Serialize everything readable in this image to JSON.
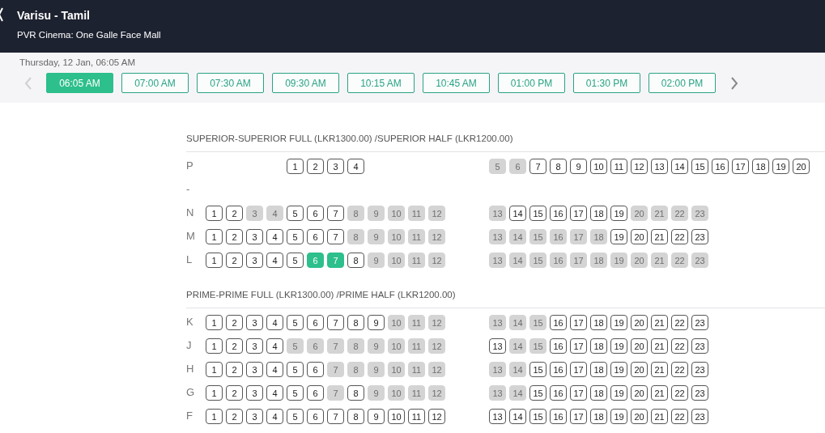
{
  "header": {
    "title": "Varisu - Tamil",
    "subtitle": "PVR Cinema: One Galle Face Mall"
  },
  "date": "Thursday, 12 Jan, 06:05 AM",
  "showtimes": [
    {
      "label": "06:05 AM",
      "selected": true
    },
    {
      "label": "07:00 AM",
      "selected": false
    },
    {
      "label": "07:30 AM",
      "selected": false
    },
    {
      "label": "09:30 AM",
      "selected": false
    },
    {
      "label": "10:15 AM",
      "selected": false
    },
    {
      "label": "10:45 AM",
      "selected": false
    },
    {
      "label": "01:00 PM",
      "selected": false
    },
    {
      "label": "01:30 PM",
      "selected": false
    },
    {
      "label": "02:00 PM",
      "selected": false
    }
  ],
  "sections": [
    {
      "title": "SUPERIOR-SUPERIOR FULL (LKR1300.00) /SUPERIOR HALF (LKR1200.00)",
      "rows": [
        {
          "label": "P",
          "blocks": [
            [
              {
                "number": "1",
                "sold": false,
                "selected": false
              },
              {
                "number": "2",
                "sold": false,
                "selected": false
              },
              {
                "number": "3",
                "sold": false,
                "selected": false
              },
              {
                "number": "4",
                "sold": false,
                "selected": false
              }
            ],
            [
              {
                "number": "5",
                "sold": true,
                "selected": false
              },
              {
                "number": "6",
                "sold": true,
                "selected": false
              },
              {
                "number": "7",
                "sold": false,
                "selected": false
              },
              {
                "number": "8",
                "sold": false,
                "selected": false
              },
              {
                "number": "9",
                "sold": false,
                "selected": false
              },
              {
                "number": "10",
                "sold": false,
                "selected": false
              },
              {
                "number": "11",
                "sold": false,
                "selected": false
              },
              {
                "number": "12",
                "sold": false,
                "selected": false
              },
              {
                "number": "13",
                "sold": false,
                "selected": false
              },
              {
                "number": "14",
                "sold": false,
                "selected": false
              },
              {
                "number": "15",
                "sold": false,
                "selected": false
              },
              {
                "number": "16",
                "sold": false,
                "selected": false
              },
              {
                "number": "17",
                "sold": false,
                "selected": false
              },
              {
                "number": "18",
                "sold": false,
                "selected": false
              },
              {
                "number": "19",
                "sold": false,
                "selected": false
              },
              {
                "number": "20",
                "sold": false,
                "selected": false
              }
            ]
          ]
        },
        {
          "label": "-",
          "blocks": []
        },
        {
          "label": "N",
          "blocks": [
            [
              {
                "number": "1",
                "sold": false,
                "selected": false
              },
              {
                "number": "2",
                "sold": false,
                "selected": false
              },
              {
                "number": "3",
                "sold": true,
                "selected": false
              },
              {
                "number": "4",
                "sold": true,
                "selected": false
              },
              {
                "number": "5",
                "sold": false,
                "selected": false
              },
              {
                "number": "6",
                "sold": false,
                "selected": false
              },
              {
                "number": "7",
                "sold": false,
                "selected": false
              },
              {
                "number": "8",
                "sold": true,
                "selected": false
              },
              {
                "number": "9",
                "sold": true,
                "selected": false
              },
              {
                "number": "10",
                "sold": true,
                "selected": false
              },
              {
                "number": "11",
                "sold": true,
                "selected": false
              },
              {
                "number": "12",
                "sold": true,
                "selected": false
              }
            ],
            [
              {
                "number": "13",
                "sold": true,
                "selected": false
              },
              {
                "number": "14",
                "sold": false,
                "selected": false
              },
              {
                "number": "15",
                "sold": false,
                "selected": false
              },
              {
                "number": "16",
                "sold": false,
                "selected": false
              },
              {
                "number": "17",
                "sold": false,
                "selected": false
              },
              {
                "number": "18",
                "sold": false,
                "selected": false
              },
              {
                "number": "19",
                "sold": false,
                "selected": false
              },
              {
                "number": "20",
                "sold": true,
                "selected": false
              },
              {
                "number": "21",
                "sold": true,
                "selected": false
              },
              {
                "number": "22",
                "sold": true,
                "selected": false
              },
              {
                "number": "23",
                "sold": true,
                "selected": false
              }
            ]
          ]
        },
        {
          "label": "M",
          "blocks": [
            [
              {
                "number": "1",
                "sold": false,
                "selected": false
              },
              {
                "number": "2",
                "sold": false,
                "selected": false
              },
              {
                "number": "3",
                "sold": false,
                "selected": false
              },
              {
                "number": "4",
                "sold": false,
                "selected": false
              },
              {
                "number": "5",
                "sold": false,
                "selected": false
              },
              {
                "number": "6",
                "sold": false,
                "selected": false
              },
              {
                "number": "7",
                "sold": false,
                "selected": false
              },
              {
                "number": "8",
                "sold": true,
                "selected": false
              },
              {
                "number": "9",
                "sold": true,
                "selected": false
              },
              {
                "number": "10",
                "sold": true,
                "selected": false
              },
              {
                "number": "11",
                "sold": true,
                "selected": false
              },
              {
                "number": "12",
                "sold": true,
                "selected": false
              }
            ],
            [
              {
                "number": "13",
                "sold": true,
                "selected": false
              },
              {
                "number": "14",
                "sold": true,
                "selected": false
              },
              {
                "number": "15",
                "sold": true,
                "selected": false
              },
              {
                "number": "16",
                "sold": true,
                "selected": false
              },
              {
                "number": "17",
                "sold": true,
                "selected": false
              },
              {
                "number": "18",
                "sold": true,
                "selected": false
              },
              {
                "number": "19",
                "sold": false,
                "selected": false
              },
              {
                "number": "20",
                "sold": false,
                "selected": false
              },
              {
                "number": "21",
                "sold": false,
                "selected": false
              },
              {
                "number": "22",
                "sold": false,
                "selected": false
              },
              {
                "number": "23",
                "sold": false,
                "selected": false
              }
            ]
          ]
        },
        {
          "label": "L",
          "blocks": [
            [
              {
                "number": "1",
                "sold": false,
                "selected": false
              },
              {
                "number": "2",
                "sold": false,
                "selected": false
              },
              {
                "number": "3",
                "sold": false,
                "selected": false
              },
              {
                "number": "4",
                "sold": false,
                "selected": false
              },
              {
                "number": "5",
                "sold": false,
                "selected": false
              },
              {
                "number": "6",
                "sold": false,
                "selected": true
              },
              {
                "number": "7",
                "sold": false,
                "selected": true
              },
              {
                "number": "8",
                "sold": false,
                "selected": false
              },
              {
                "number": "9",
                "sold": true,
                "selected": false
              },
              {
                "number": "10",
                "sold": true,
                "selected": false
              },
              {
                "number": "11",
                "sold": true,
                "selected": false
              },
              {
                "number": "12",
                "sold": true,
                "selected": false
              }
            ],
            [
              {
                "number": "13",
                "sold": true,
                "selected": false
              },
              {
                "number": "14",
                "sold": true,
                "selected": false
              },
              {
                "number": "15",
                "sold": true,
                "selected": false
              },
              {
                "number": "16",
                "sold": true,
                "selected": false
              },
              {
                "number": "17",
                "sold": true,
                "selected": false
              },
              {
                "number": "18",
                "sold": true,
                "selected": false
              },
              {
                "number": "19",
                "sold": true,
                "selected": false
              },
              {
                "number": "20",
                "sold": true,
                "selected": false
              },
              {
                "number": "21",
                "sold": true,
                "selected": false
              },
              {
                "number": "22",
                "sold": true,
                "selected": false
              },
              {
                "number": "23",
                "sold": true,
                "selected": false
              }
            ]
          ]
        }
      ]
    },
    {
      "title": "PRIME-PRIME FULL (LKR1300.00) /PRIME HALF (LKR1200.00)",
      "rows": [
        {
          "label": "K",
          "blocks": [
            [
              {
                "number": "1",
                "sold": false,
                "selected": false
              },
              {
                "number": "2",
                "sold": false,
                "selected": false
              },
              {
                "number": "3",
                "sold": false,
                "selected": false
              },
              {
                "number": "4",
                "sold": false,
                "selected": false
              },
              {
                "number": "5",
                "sold": false,
                "selected": false
              },
              {
                "number": "6",
                "sold": false,
                "selected": false
              },
              {
                "number": "7",
                "sold": false,
                "selected": false
              },
              {
                "number": "8",
                "sold": false,
                "selected": false
              },
              {
                "number": "9",
                "sold": false,
                "selected": false
              },
              {
                "number": "10",
                "sold": true,
                "selected": false
              },
              {
                "number": "11",
                "sold": true,
                "selected": false
              },
              {
                "number": "12",
                "sold": true,
                "selected": false
              }
            ],
            [
              {
                "number": "13",
                "sold": true,
                "selected": false
              },
              {
                "number": "14",
                "sold": true,
                "selected": false
              },
              {
                "number": "15",
                "sold": true,
                "selected": false
              },
              {
                "number": "16",
                "sold": false,
                "selected": false
              },
              {
                "number": "17",
                "sold": false,
                "selected": false
              },
              {
                "number": "18",
                "sold": false,
                "selected": false
              },
              {
                "number": "19",
                "sold": false,
                "selected": false
              },
              {
                "number": "20",
                "sold": false,
                "selected": false
              },
              {
                "number": "21",
                "sold": false,
                "selected": false
              },
              {
                "number": "22",
                "sold": false,
                "selected": false
              },
              {
                "number": "23",
                "sold": false,
                "selected": false
              }
            ]
          ]
        },
        {
          "label": "J",
          "blocks": [
            [
              {
                "number": "1",
                "sold": false,
                "selected": false
              },
              {
                "number": "2",
                "sold": false,
                "selected": false
              },
              {
                "number": "3",
                "sold": false,
                "selected": false
              },
              {
                "number": "4",
                "sold": false,
                "selected": false
              },
              {
                "number": "5",
                "sold": true,
                "selected": false
              },
              {
                "number": "6",
                "sold": true,
                "selected": false
              },
              {
                "number": "7",
                "sold": true,
                "selected": false
              },
              {
                "number": "8",
                "sold": true,
                "selected": false
              },
              {
                "number": "9",
                "sold": true,
                "selected": false
              },
              {
                "number": "10",
                "sold": true,
                "selected": false
              },
              {
                "number": "11",
                "sold": true,
                "selected": false
              },
              {
                "number": "12",
                "sold": true,
                "selected": false
              }
            ],
            [
              {
                "number": "13",
                "sold": false,
                "selected": false
              },
              {
                "number": "14",
                "sold": true,
                "selected": false
              },
              {
                "number": "15",
                "sold": true,
                "selected": false
              },
              {
                "number": "16",
                "sold": false,
                "selected": false
              },
              {
                "number": "17",
                "sold": false,
                "selected": false
              },
              {
                "number": "18",
                "sold": false,
                "selected": false
              },
              {
                "number": "19",
                "sold": false,
                "selected": false
              },
              {
                "number": "20",
                "sold": false,
                "selected": false
              },
              {
                "number": "21",
                "sold": false,
                "selected": false
              },
              {
                "number": "22",
                "sold": false,
                "selected": false
              },
              {
                "number": "23",
                "sold": false,
                "selected": false
              }
            ]
          ]
        },
        {
          "label": "H",
          "blocks": [
            [
              {
                "number": "1",
                "sold": false,
                "selected": false
              },
              {
                "number": "2",
                "sold": false,
                "selected": false
              },
              {
                "number": "3",
                "sold": false,
                "selected": false
              },
              {
                "number": "4",
                "sold": false,
                "selected": false
              },
              {
                "number": "5",
                "sold": false,
                "selected": false
              },
              {
                "number": "6",
                "sold": false,
                "selected": false
              },
              {
                "number": "7",
                "sold": true,
                "selected": false
              },
              {
                "number": "8",
                "sold": true,
                "selected": false
              },
              {
                "number": "9",
                "sold": true,
                "selected": false
              },
              {
                "number": "10",
                "sold": true,
                "selected": false
              },
              {
                "number": "11",
                "sold": true,
                "selected": false
              },
              {
                "number": "12",
                "sold": true,
                "selected": false
              }
            ],
            [
              {
                "number": "13",
                "sold": true,
                "selected": false
              },
              {
                "number": "14",
                "sold": true,
                "selected": false
              },
              {
                "number": "15",
                "sold": false,
                "selected": false
              },
              {
                "number": "16",
                "sold": false,
                "selected": false
              },
              {
                "number": "17",
                "sold": false,
                "selected": false
              },
              {
                "number": "18",
                "sold": false,
                "selected": false
              },
              {
                "number": "19",
                "sold": false,
                "selected": false
              },
              {
                "number": "20",
                "sold": false,
                "selected": false
              },
              {
                "number": "21",
                "sold": false,
                "selected": false
              },
              {
                "number": "22",
                "sold": false,
                "selected": false
              },
              {
                "number": "23",
                "sold": false,
                "selected": false
              }
            ]
          ]
        },
        {
          "label": "G",
          "blocks": [
            [
              {
                "number": "1",
                "sold": false,
                "selected": false
              },
              {
                "number": "2",
                "sold": false,
                "selected": false
              },
              {
                "number": "3",
                "sold": false,
                "selected": false
              },
              {
                "number": "4",
                "sold": false,
                "selected": false
              },
              {
                "number": "5",
                "sold": false,
                "selected": false
              },
              {
                "number": "6",
                "sold": false,
                "selected": false
              },
              {
                "number": "7",
                "sold": true,
                "selected": false
              },
              {
                "number": "8",
                "sold": false,
                "selected": false
              },
              {
                "number": "9",
                "sold": true,
                "selected": false
              },
              {
                "number": "10",
                "sold": true,
                "selected": false
              },
              {
                "number": "11",
                "sold": true,
                "selected": false
              },
              {
                "number": "12",
                "sold": true,
                "selected": false
              }
            ],
            [
              {
                "number": "13",
                "sold": true,
                "selected": false
              },
              {
                "number": "14",
                "sold": true,
                "selected": false
              },
              {
                "number": "15",
                "sold": false,
                "selected": false
              },
              {
                "number": "16",
                "sold": false,
                "selected": false
              },
              {
                "number": "17",
                "sold": false,
                "selected": false
              },
              {
                "number": "18",
                "sold": false,
                "selected": false
              },
              {
                "number": "19",
                "sold": false,
                "selected": false
              },
              {
                "number": "20",
                "sold": false,
                "selected": false
              },
              {
                "number": "21",
                "sold": false,
                "selected": false
              },
              {
                "number": "22",
                "sold": false,
                "selected": false
              },
              {
                "number": "23",
                "sold": false,
                "selected": false
              }
            ]
          ]
        },
        {
          "label": "F",
          "blocks": [
            [
              {
                "number": "1",
                "sold": false,
                "selected": false
              },
              {
                "number": "2",
                "sold": false,
                "selected": false
              },
              {
                "number": "3",
                "sold": false,
                "selected": false
              },
              {
                "number": "4",
                "sold": false,
                "selected": false
              },
              {
                "number": "5",
                "sold": false,
                "selected": false
              },
              {
                "number": "6",
                "sold": false,
                "selected": false
              },
              {
                "number": "7",
                "sold": false,
                "selected": false
              },
              {
                "number": "8",
                "sold": false,
                "selected": false
              },
              {
                "number": "9",
                "sold": false,
                "selected": false
              },
              {
                "number": "10",
                "sold": false,
                "selected": false
              },
              {
                "number": "11",
                "sold": false,
                "selected": false
              },
              {
                "number": "12",
                "sold": false,
                "selected": false
              }
            ],
            [
              {
                "number": "13",
                "sold": false,
                "selected": false
              },
              {
                "number": "14",
                "sold": false,
                "selected": false
              },
              {
                "number": "15",
                "sold": false,
                "selected": false
              },
              {
                "number": "16",
                "sold": false,
                "selected": false
              },
              {
                "number": "17",
                "sold": false,
                "selected": false
              },
              {
                "number": "18",
                "sold": false,
                "selected": false
              },
              {
                "number": "19",
                "sold": false,
                "selected": false
              },
              {
                "number": "20",
                "sold": false,
                "selected": false
              },
              {
                "number": "21",
                "sold": false,
                "selected": false
              },
              {
                "number": "22",
                "sold": false,
                "selected": false
              },
              {
                "number": "23",
                "sold": false,
                "selected": false
              }
            ]
          ]
        }
      ]
    }
  ]
}
